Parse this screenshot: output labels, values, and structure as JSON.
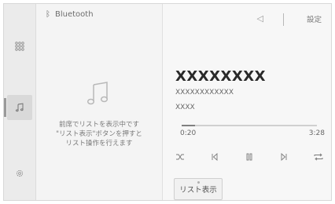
{
  "source": {
    "name": "Bluetooth",
    "icon": "bluetooth-icon"
  },
  "header": {
    "setup_label": "設定",
    "volume_icon": "volume-icon"
  },
  "sidebar": {
    "items": [
      {
        "icon": "grid-icon",
        "active": false
      },
      {
        "icon": "music-icon",
        "active": true
      },
      {
        "icon": "settings-gear-icon",
        "active": false
      }
    ]
  },
  "list_panel": {
    "message_lines": [
      "前席でリストを表示中です",
      "\"リスト表示\"ボタンを押すと",
      "リスト操作を行えます"
    ]
  },
  "track": {
    "title": "XXXXXXXX",
    "artist": "XXXXXXXXXXXX",
    "album": "XXXX"
  },
  "progress": {
    "current": "0:20",
    "total": "3:28",
    "fraction": 0.1
  },
  "controls": [
    "shuffle-icon",
    "previous-track-icon",
    "pause-icon",
    "next-track-icon",
    "repeat-icon"
  ],
  "list_button": {
    "label": "リスト表示"
  }
}
